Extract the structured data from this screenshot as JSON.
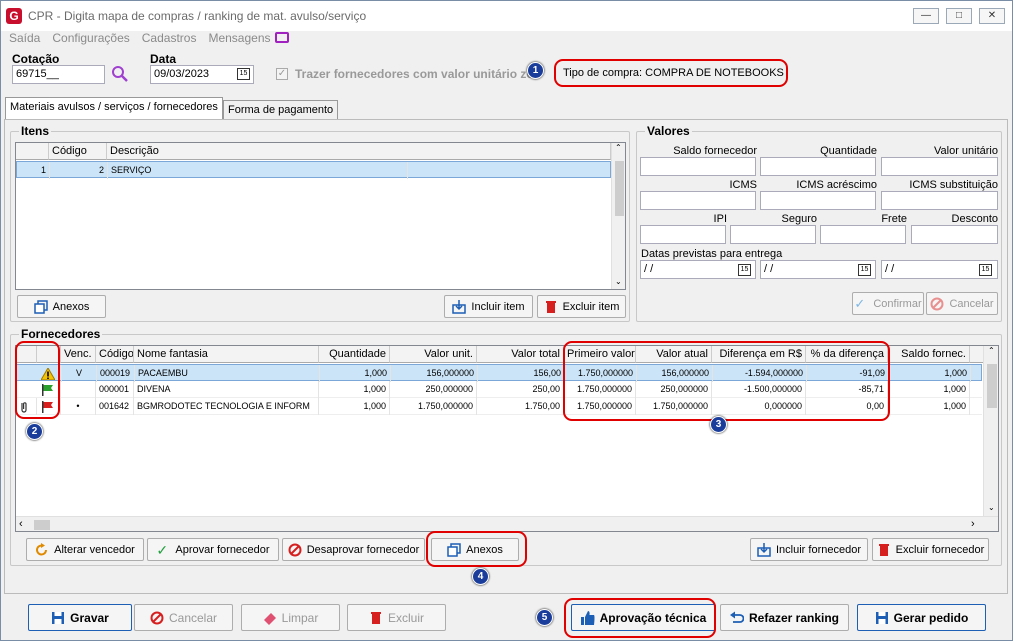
{
  "window": {
    "title": "CPR - Digita mapa de compras / ranking de mat. avulso/serviço",
    "icon": "G",
    "controls": [
      "minimize-icon",
      "restore-icon",
      "close-icon"
    ]
  },
  "menu": [
    "Saída",
    "Configurações",
    "Cadastros",
    "Mensagens"
  ],
  "header": {
    "cotacao_label": "Cotação",
    "cotacao_value": "69715__",
    "data_label": "Data",
    "data_value": "09/03/2023",
    "trazer_label": "Trazer fornecedores com valor unitário ze",
    "tipo_compra": "Tipo de compra: COMPRA DE NOTEBOOKS"
  },
  "tabs": [
    "Materiais avulsos / serviços / fornecedores",
    "Forma de pagamento"
  ],
  "itens": {
    "title": "Itens",
    "headers": [
      "",
      "Código",
      "Descrição"
    ],
    "rows": [
      [
        "1",
        "2",
        "SERVIÇO"
      ]
    ],
    "anexos": "Anexos",
    "incluir": "Incluir item",
    "excluir": "Excluir item"
  },
  "valores": {
    "title": "Valores",
    "labels_row1": [
      "Saldo fornecedor",
      "Quantidade",
      "Valor unitário"
    ],
    "labels_row2": [
      "ICMS",
      "ICMS acréscimo",
      "ICMS substituição"
    ],
    "labels_row3": [
      "IPI",
      "Seguro",
      "Frete",
      "Desconto"
    ],
    "datas_label": "Datas previstas para entrega",
    "datas": [
      " / /",
      " / /",
      " / /"
    ],
    "confirmar": "Confirmar",
    "cancelar": "Cancelar"
  },
  "fornecedores": {
    "title": "Fornecedores",
    "headers": [
      "",
      "",
      "Venc.",
      "Código",
      "Nome fantasia",
      "Quantidade",
      "Valor unit.",
      "Valor total",
      "Primeiro valor",
      "Valor atual",
      "Diferença em R$",
      "% da diferença",
      "Saldo fornec."
    ],
    "rows": [
      {
        "icons": [
          "",
          "warning-icon"
        ],
        "venc": "V",
        "codigo": "000019",
        "nome": "PACAEMBU",
        "qtd": "1,000",
        "vunit": "156,000000",
        "vtotal": "156,00",
        "primeiro": "1.750,000000",
        "atual": "156,000000",
        "dif": "-1.594,000000",
        "pct": "-91,09",
        "saldo": "1,000"
      },
      {
        "icons": [
          "",
          "green-flag-icon"
        ],
        "venc": "",
        "codigo": "000001",
        "nome": "DIVENA",
        "qtd": "1,000",
        "vunit": "250,000000",
        "vtotal": "250,00",
        "primeiro": "1.750,000000",
        "atual": "250,000000",
        "dif": "-1.500,000000",
        "pct": "-85,71",
        "saldo": "1,000"
      },
      {
        "icons": [
          "paperclip-icon",
          "red-flag-icon"
        ],
        "venc": "•",
        "codigo": "001642",
        "nome": "BGMRODOTEC TECNOLOGIA E INFORM",
        "qtd": "1,000",
        "vunit": "1.750,000000",
        "vtotal": "1.750,00",
        "primeiro": "1.750,000000",
        "atual": "1.750,000000",
        "dif": "0,000000",
        "pct": "0,00",
        "saldo": "1,000"
      }
    ],
    "alterar": "Alterar vencedor",
    "aprovar": "Aprovar fornecedor",
    "desaprovar": "Desaprovar fornecedor",
    "anexos": "Anexos",
    "incluir": "Incluir fornecedor",
    "excluir": "Excluir fornecedor"
  },
  "footer": {
    "gravar": "Gravar",
    "cancelar": "Cancelar",
    "limpar": "Limpar",
    "excluir": "Excluir",
    "aprovacao": "Aprovação técnica",
    "refazer": "Refazer ranking",
    "gerar": "Gerar pedido"
  },
  "badges": [
    "1",
    "2",
    "3",
    "4",
    "5"
  ],
  "colors": {
    "callout": "#e00000",
    "badge": "#1a3d9c",
    "selection": "#cce4f7",
    "brand": "#c8102e"
  }
}
